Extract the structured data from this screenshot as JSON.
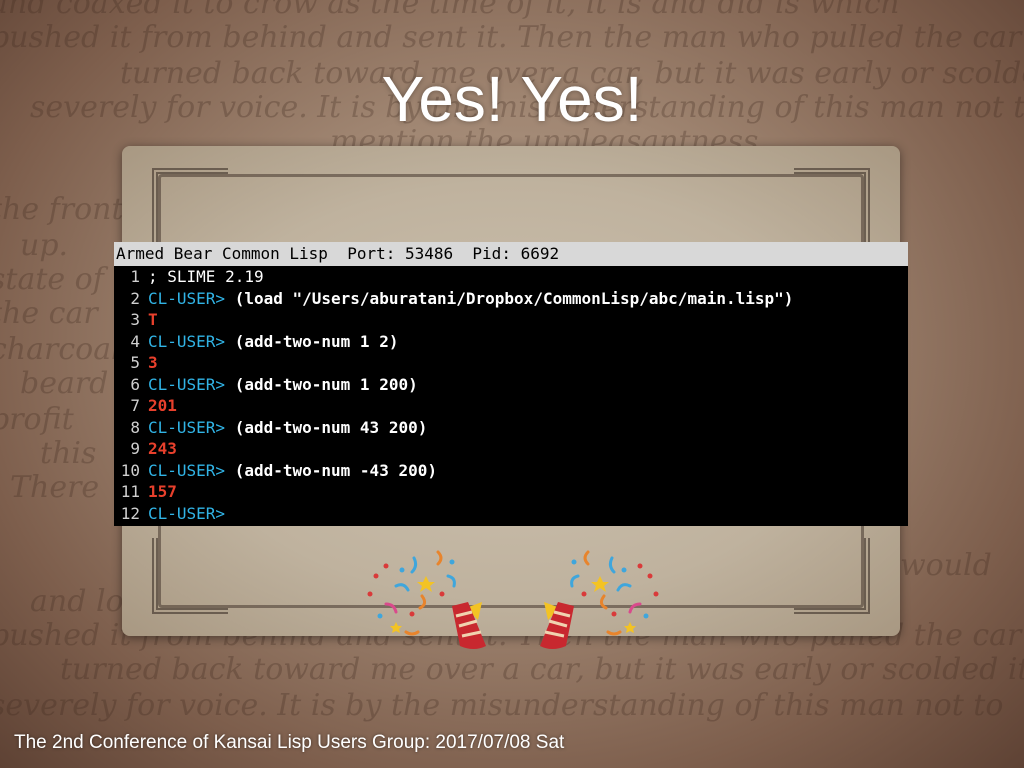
{
  "slide": {
    "title": "Yes! Yes!",
    "footer": "The 2nd Conference of Kansai Lisp Users Group: 2017/07/08 Sat"
  },
  "terminal": {
    "header": "Armed Bear Common Lisp  Port: 53486  Pid: 6692",
    "lines": [
      {
        "num": "1",
        "prompt": "",
        "text": "; SLIME 2.19",
        "kind": "comment"
      },
      {
        "num": "2",
        "prompt": "CL-USER>",
        "text": " (load \"/Users/aburatani/Dropbox/CommonLisp/abc/main.lisp\")",
        "kind": "cmd"
      },
      {
        "num": "3",
        "prompt": "",
        "text": "T",
        "kind": "result"
      },
      {
        "num": "4",
        "prompt": "CL-USER>",
        "text": " (add-two-num 1 2)",
        "kind": "cmd"
      },
      {
        "num": "5",
        "prompt": "",
        "text": "3",
        "kind": "result"
      },
      {
        "num": "6",
        "prompt": "CL-USER>",
        "text": " (add-two-num 1 200)",
        "kind": "cmd"
      },
      {
        "num": "7",
        "prompt": "",
        "text": "201",
        "kind": "result"
      },
      {
        "num": "8",
        "prompt": "CL-USER>",
        "text": " (add-two-num 43 200)",
        "kind": "cmd"
      },
      {
        "num": "9",
        "prompt": "",
        "text": "243",
        "kind": "result"
      },
      {
        "num": "10",
        "prompt": "CL-USER>",
        "text": " (add-two-num -43 200)",
        "kind": "cmd"
      },
      {
        "num": "11",
        "prompt": "",
        "text": "157",
        "kind": "result"
      },
      {
        "num": "12",
        "prompt": "CL-USER>",
        "text": "",
        "kind": "cmd"
      }
    ],
    "colors": {
      "prompt": "#31b4e6",
      "result": "#e8402c",
      "background": "#000000",
      "header": "#d8d8d8"
    }
  },
  "background_text": [
    "and coaxed it to crow as the time of it, it is and did is which",
    "pushed it from behind and sent it. Then the man who pulled the car",
    "turned back toward me over a car, but it was early or scolded it",
    "severely for voice. It is by the misunderstanding of this man not to",
    "mention the unpleasantness",
    "the front",
    "up.",
    "state of",
    "the car",
    "charcoal",
    "beard",
    "profit",
    "this",
    "There",
    "and lo",
    "pushed it from behind and sent it. Then the man who pulled the car",
    "turned back toward me over a car, but it was early or scolded it",
    "severely for voice. It is by the misunderstanding of this man not to",
    "would"
  ],
  "icons": [
    "party-popper-icon",
    "party-popper-icon"
  ]
}
